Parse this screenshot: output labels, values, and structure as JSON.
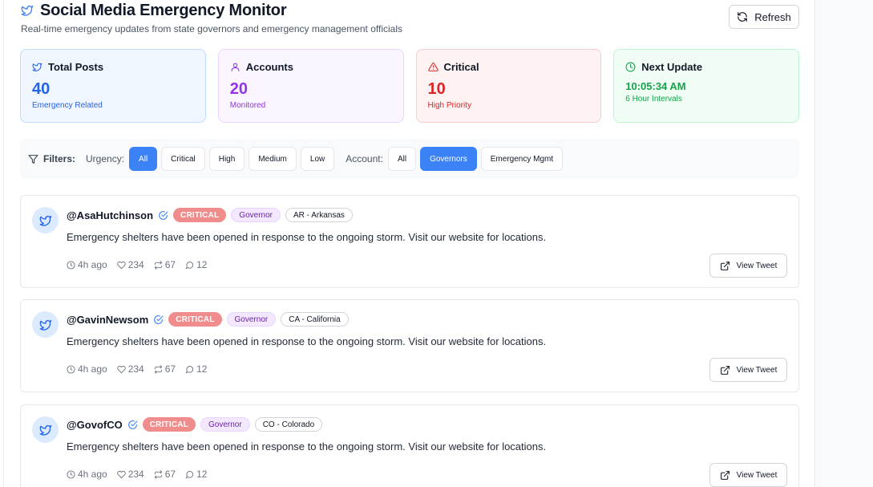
{
  "header": {
    "title": "Social Media Emergency Monitor",
    "subtitle": "Real-time emergency updates from state governors and emergency management officials",
    "refresh_label": "Refresh"
  },
  "stats": {
    "total_posts": {
      "label": "Total Posts",
      "value": "40",
      "sub": "Emergency Related",
      "color": "#2563eb"
    },
    "accounts": {
      "label": "Accounts",
      "value": "20",
      "sub": "Monitored",
      "color": "#9333ea"
    },
    "critical": {
      "label": "Critical",
      "value": "10",
      "sub": "High Priority",
      "color": "#dc2626"
    },
    "next_update": {
      "label": "Next Update",
      "value": "10:05:34 AM",
      "sub": "6 Hour Intervals",
      "color": "#16a34a"
    }
  },
  "filters": {
    "label": "Filters:",
    "urgency_label": "Urgency:",
    "urgency_options": [
      "All",
      "Critical",
      "High",
      "Medium",
      "Low"
    ],
    "urgency_selected": "All",
    "account_label": "Account:",
    "account_options": [
      "All",
      "Governors",
      "Emergency Mgmt"
    ],
    "account_selected": "Governors"
  },
  "posts": [
    {
      "handle": "@AsaHutchinson",
      "urgency": "CRITICAL",
      "type": "Governor",
      "state": "AR - Arkansas",
      "text": "Emergency shelters have been opened in response to the ongoing storm. Visit our website for locations.",
      "time": "4h ago",
      "likes": "234",
      "retweets": "67",
      "replies": "12",
      "view_label": "View Tweet"
    },
    {
      "handle": "@GavinNewsom",
      "urgency": "CRITICAL",
      "type": "Governor",
      "state": "CA - California",
      "text": "Emergency shelters have been opened in response to the ongoing storm. Visit our website for locations.",
      "time": "4h ago",
      "likes": "234",
      "retweets": "67",
      "replies": "12",
      "view_label": "View Tweet"
    },
    {
      "handle": "@GovofCO",
      "urgency": "CRITICAL",
      "type": "Governor",
      "state": "CO - Colorado",
      "text": "Emergency shelters have been opened in response to the ongoing storm. Visit our website for locations.",
      "time": "4h ago",
      "likes": "234",
      "retweets": "67",
      "replies": "12",
      "view_label": "View Tweet"
    }
  ]
}
